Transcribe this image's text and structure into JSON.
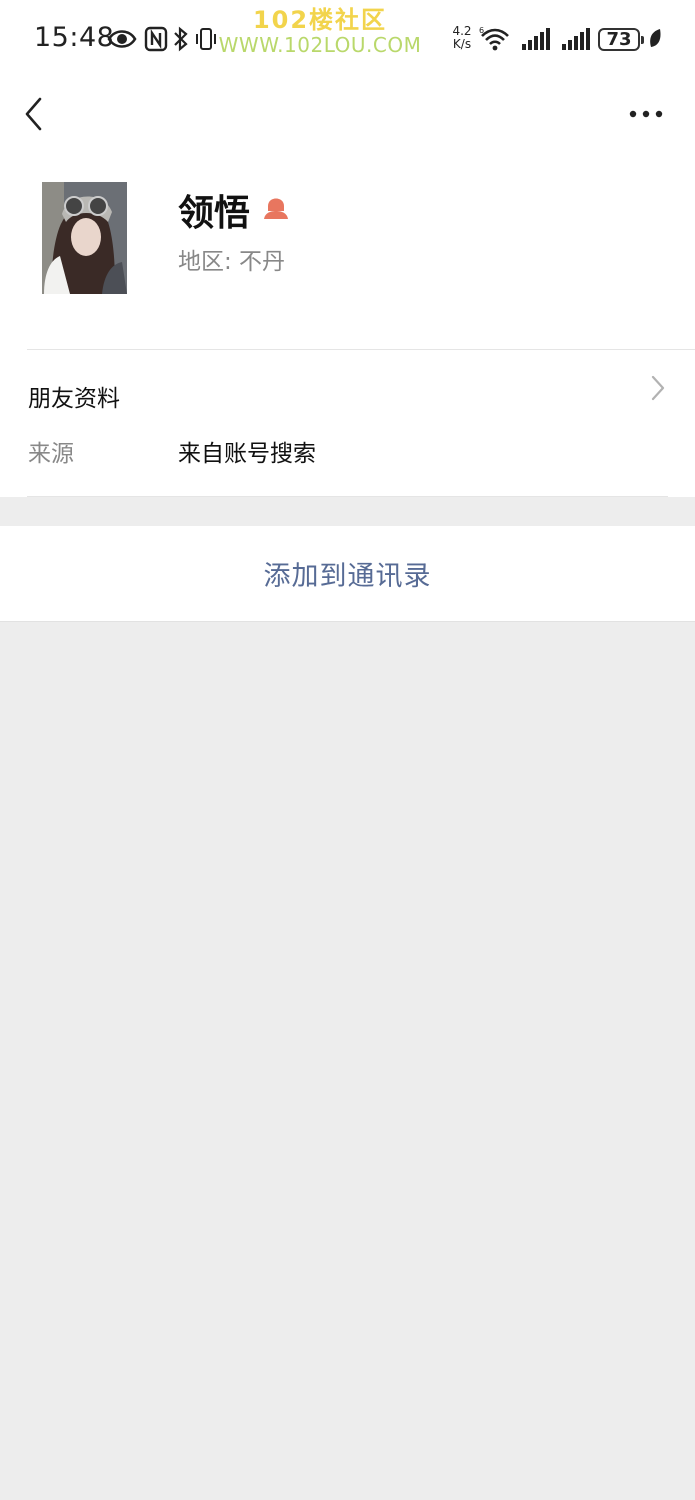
{
  "status_bar": {
    "time": "15:48",
    "net_speed_value": "4.2",
    "net_speed_unit": "K/s",
    "battery": "73",
    "icons": [
      "eye-icon",
      "nfc-icon",
      "bluetooth-icon",
      "vibrate-icon",
      "wifi-6-icon",
      "signal-icon",
      "signal-icon",
      "leaf-icon"
    ]
  },
  "watermark": {
    "title": "102楼社区",
    "url": "WWW.102LOU.COM"
  },
  "nav": {
    "back_icon": "chevron-left-icon",
    "more_icon": "more-dots-icon"
  },
  "profile": {
    "name": "领悟",
    "gender_icon": "female-icon",
    "region": "地区:  不丹"
  },
  "friend_info": {
    "title": "朋友资料",
    "source_label": "来源",
    "source_value": "来自账号搜索"
  },
  "actions": {
    "add_contact_label": "添加到通讯录"
  },
  "colors": {
    "link_blue": "#576b95",
    "female_accent": "#e8765f",
    "background": "#ededed"
  }
}
